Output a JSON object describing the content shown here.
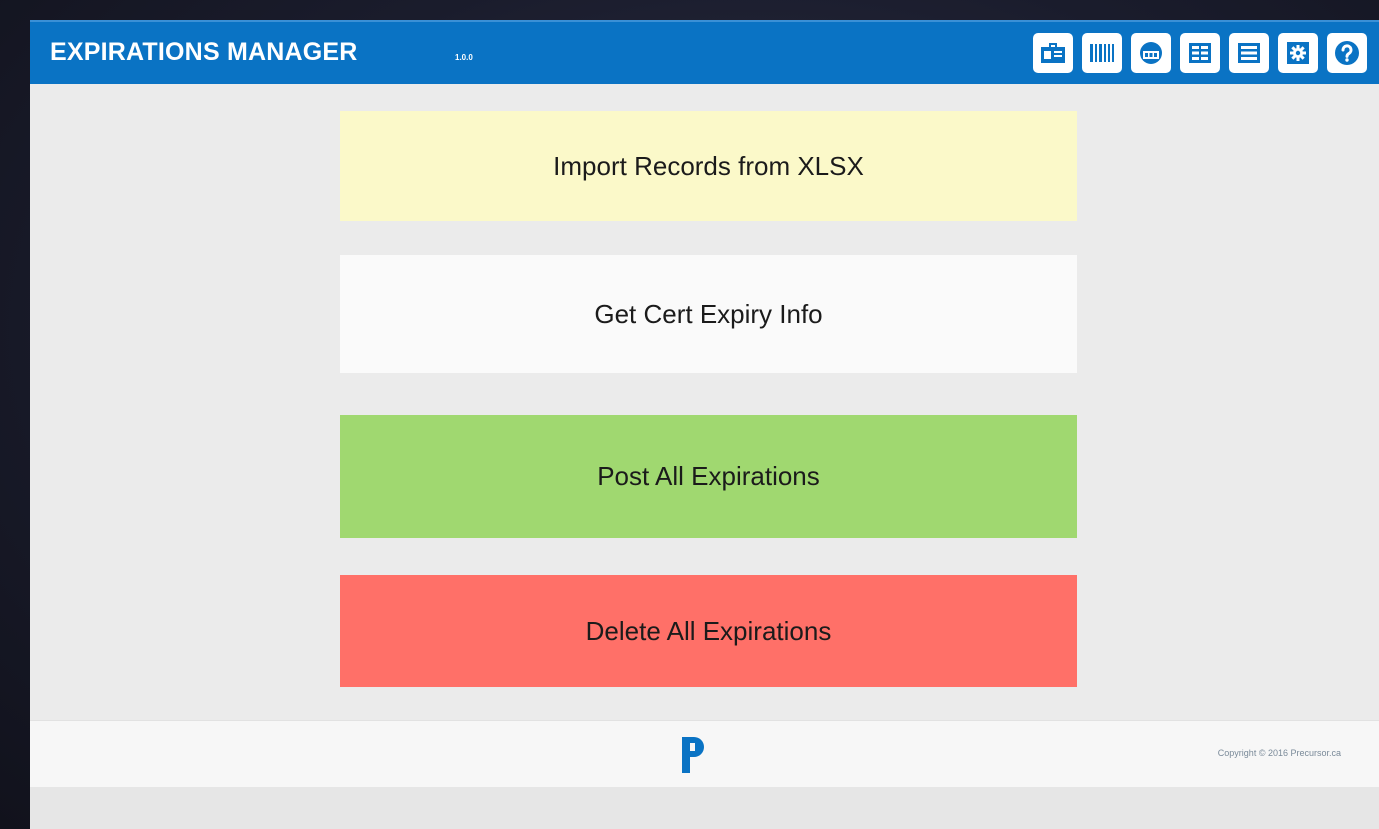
{
  "app": {
    "title": "EXPIRATIONS MANAGER",
    "version": "1.0.0",
    "accent_color": "#0a73c4"
  },
  "toolbar": {
    "icons": [
      "id-card-icon",
      "barcode-icon",
      "tape-drive-icon",
      "grid-view-icon",
      "list-view-icon",
      "gear-icon",
      "help-icon"
    ]
  },
  "actions": {
    "import": {
      "label": "Import Records from XLSX",
      "color": "#fbf9c9"
    },
    "cert": {
      "label": "Get Cert Expiry Info",
      "color": "#fafafa"
    },
    "post": {
      "label": "Post All Expirations",
      "color": "#a0d870"
    },
    "delete": {
      "label": "Delete All Expirations",
      "color": "#ff7068"
    }
  },
  "footer": {
    "logo": "precursor-logo",
    "copyright": "Copyright © 2016 Precursor.ca"
  }
}
